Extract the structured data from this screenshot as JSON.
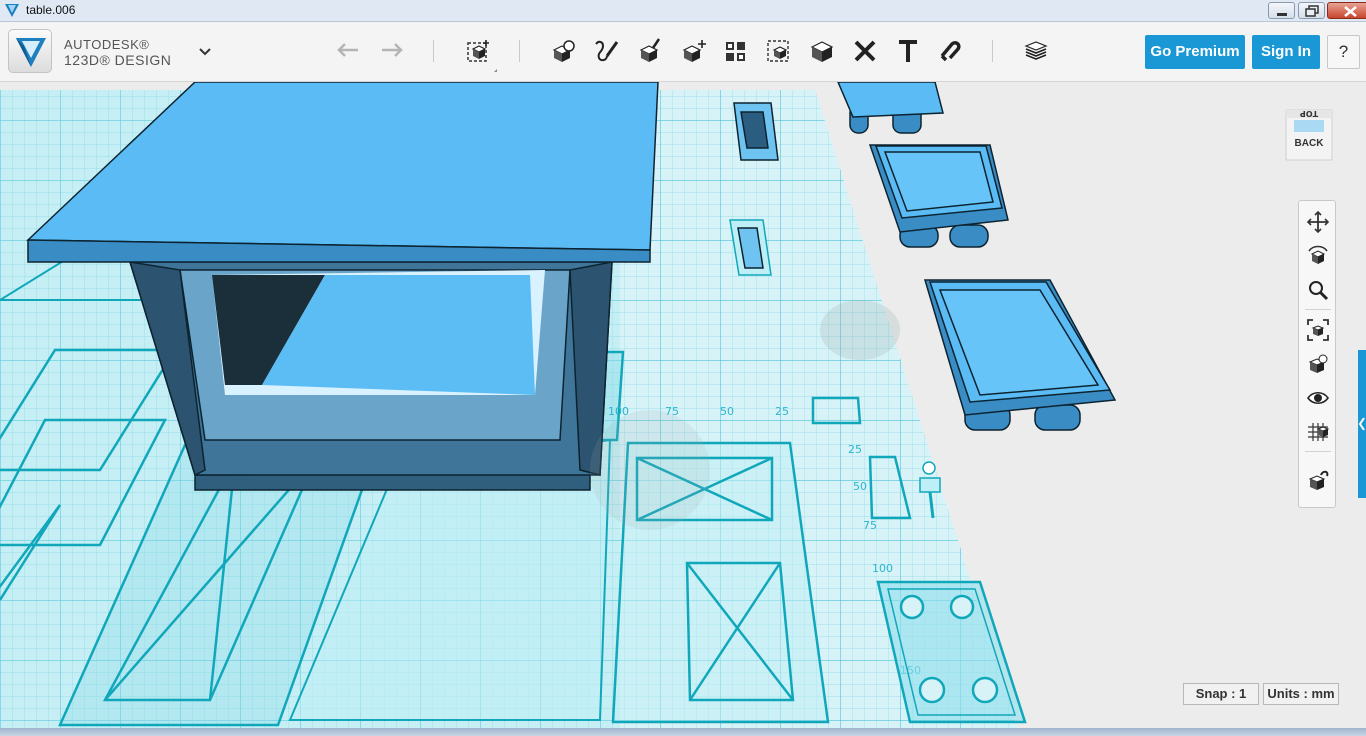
{
  "window": {
    "title": "table.006",
    "icons": {
      "app": "autodesk-app-icon",
      "minimize": "minimize-icon",
      "restore": "restore-icon",
      "close": "close-icon"
    }
  },
  "brand": {
    "line1": "AUTODESK®",
    "line2": "123D® DESIGN",
    "logo": "autodesk-logo-icon",
    "menu_icon": "chevron-down-icon"
  },
  "toolbar": {
    "history": [
      "undo-icon",
      "redo-icon"
    ],
    "tools": [
      "primitives-icon",
      "sketch-icon",
      "construct-icon",
      "modify-icon",
      "pattern-icon",
      "group-icon",
      "combine-icon",
      "measure-icon",
      "text-icon",
      "snap-icon",
      "material-icon"
    ],
    "premium_label": "Go Premium",
    "signin_label": "Sign In",
    "help_label": "?"
  },
  "viewcube": {
    "face": "BACK",
    "top_text": "TOP"
  },
  "nav_tools": [
    "pan-icon",
    "orbit-icon",
    "zoom-icon",
    "fit-all-icon",
    "view-selected-icon",
    "visibility-icon",
    "grid-display-icon",
    "material-view-icon"
  ],
  "grid_labels": {
    "horizontal": [
      "100",
      "75",
      "50",
      "25"
    ],
    "vertical": [
      "25",
      "50",
      "75",
      "100",
      "150"
    ]
  },
  "status": {
    "snap": "Snap : 1",
    "units": "Units : mm"
  },
  "colors": {
    "accent": "#1a98d5",
    "model_blue": "#5bbcf5",
    "model_dark": "#3a6f8f",
    "grid_cyan": "#21b5cc",
    "sketch_teal": "#11a7bb"
  }
}
